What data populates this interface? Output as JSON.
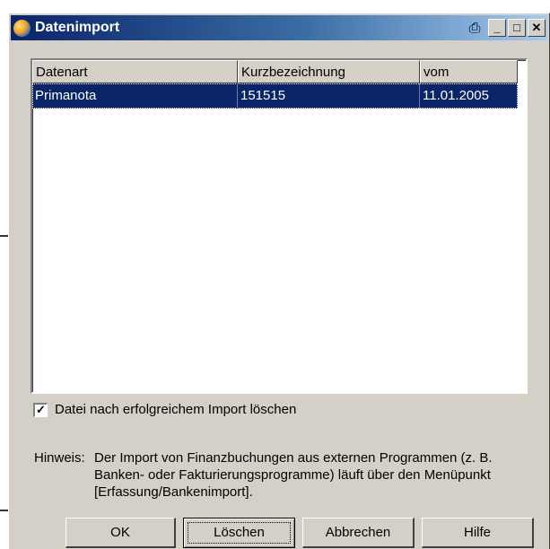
{
  "window": {
    "title": "Datenimport",
    "icon": "app-globe-icon",
    "controls": [
      "printer-icon",
      "minimize-button",
      "maximize-button",
      "close-button"
    ]
  },
  "list": {
    "columns": [
      "Datenart",
      "Kurzbezeichnung",
      "vom"
    ],
    "rows": [
      {
        "datenart": "Primanota",
        "kurzbezeichnung": "151515",
        "vom": "11.01.2005",
        "selected": true
      }
    ]
  },
  "checkbox": {
    "label": "Datei nach erfolgreichem Import löschen",
    "checked": true
  },
  "hint": {
    "label": "Hinweis:",
    "text": "Der Import von Finanzbuchungen aus externen Programmen (z. B. Banken- oder Fakturierungsprogramme) läuft über den Menüpunkt [Erfassung/Bankenimport]."
  },
  "buttons": {
    "ok": "OK",
    "delete": "Löschen",
    "cancel": "Abbrechen",
    "help": "Hilfe"
  },
  "colors": {
    "title_gradient_start": "#0a246a",
    "title_gradient_end": "#a6caf0",
    "selection": "#0a246a",
    "face": "#d4d0c8"
  }
}
